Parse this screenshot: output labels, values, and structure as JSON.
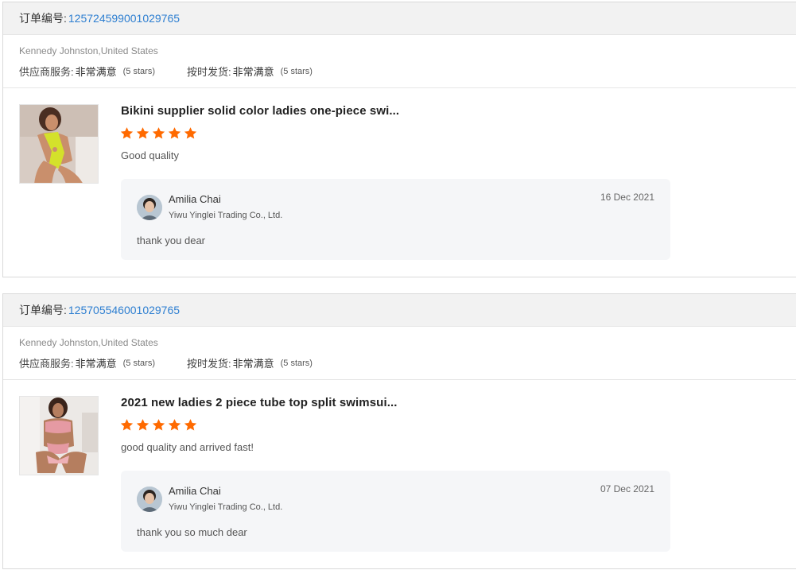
{
  "reviews": [
    {
      "order_label": "订单编号:",
      "order_number": "125724599001029765",
      "buyer": "Kennedy Johnston,United States",
      "supplier_service": {
        "label": "供应商服务:",
        "value": "非常满意",
        "stars_text": "(5 stars)"
      },
      "on_time_shipping": {
        "label": "按时发货:",
        "value": "非常满意",
        "stars_text": "(5 stars)"
      },
      "product_title": "Bikini supplier solid color ladies one-piece swi...",
      "product_image_icon": "swimsuit-photo-yellow",
      "rating": 5,
      "review_text": "Good quality",
      "reply": {
        "name": "Amilia Chai",
        "company": "Yiwu Yinglei Trading Co., Ltd.",
        "date": "16 Dec 2021",
        "text": "thank you dear"
      }
    },
    {
      "order_label": "订单编号:",
      "order_number": "125705546001029765",
      "buyer": "Kennedy Johnston,United States",
      "supplier_service": {
        "label": "供应商服务:",
        "value": "非常满意",
        "stars_text": "(5 stars)"
      },
      "on_time_shipping": {
        "label": "按时发货:",
        "value": "非常满意",
        "stars_text": "(5 stars)"
      },
      "product_title": "2021 new ladies 2 piece tube top split swimsui...",
      "product_image_icon": "swimsuit-photo-pink",
      "rating": 5,
      "review_text": "good quality and arrived fast!",
      "reply": {
        "name": "Amilia Chai",
        "company": "Yiwu Yinglei Trading Co., Ltd.",
        "date": "07 Dec 2021",
        "text": "thank you so much dear"
      }
    }
  ],
  "colors": {
    "star": "#ff6a00",
    "link": "#2e7fd1",
    "header_bg": "#f2f2f2",
    "reply_bg": "#f5f6f8"
  }
}
